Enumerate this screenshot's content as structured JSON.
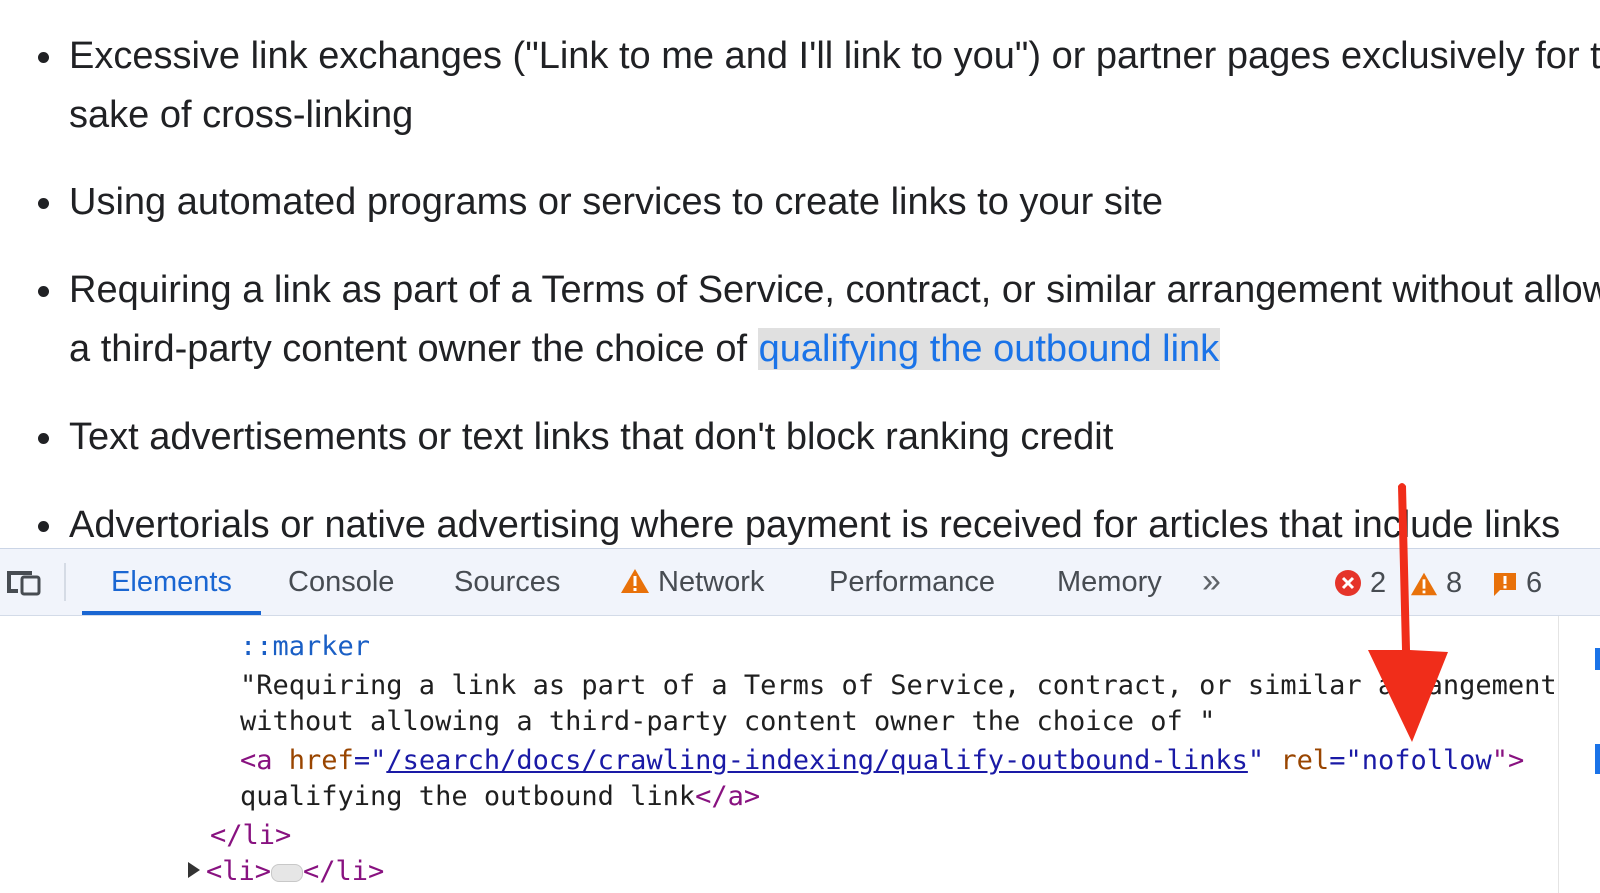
{
  "article": {
    "items": [
      {
        "line1": "Excessive link exchanges (\"Link to me and I'll link to you\") or partner pages exclusively for the",
        "line2": "sake of cross-linking"
      },
      {
        "line1": "Using automated programs or services to create links to your site"
      },
      {
        "line1": "Requiring a link as part of a Terms of Service, contract, or similar arrangement without allowing",
        "line2_pre": "a third-party content owner the choice of ",
        "link": "qualifying the outbound link"
      },
      {
        "line1": "Text advertisements or text links that don't block ranking credit"
      },
      {
        "line1": "Advertorials or native advertising where payment is received for articles that include links"
      }
    ]
  },
  "devtools": {
    "tabs": [
      "Elements",
      "Console",
      "Sources",
      "Network",
      "Performance",
      "Memory"
    ],
    "more_tabs_glyph": "»",
    "status": {
      "errors": "2",
      "warnings": "8",
      "issues": "6"
    },
    "code": {
      "marker": "::marker",
      "text_line1": "\"Requiring a link as part of a Terms of Service, contract, or similar arrangement",
      "text_line2": "without allowing a third-party content owner the choice of \"",
      "a_open": "<a",
      "href_attr": "href",
      "eq_quote": "=\"",
      "href_value": "/search/docs/crawling-indexing/qualify-outbound-links",
      "quote": "\"",
      "rel_attr": "rel",
      "rel_value": "nofollow",
      "a_open_close": "\">",
      "link_text": "qualifying the outbound link",
      "a_close": "</a>",
      "li_close": "</li>",
      "li_open_next": "<li>",
      "li_close_next": "</li>"
    }
  },
  "colors": {
    "accent": "#1a66d2",
    "link": "#1a73e8",
    "arrow": "#f02d1a",
    "error": "#e5342a",
    "warning": "#e8710a"
  }
}
